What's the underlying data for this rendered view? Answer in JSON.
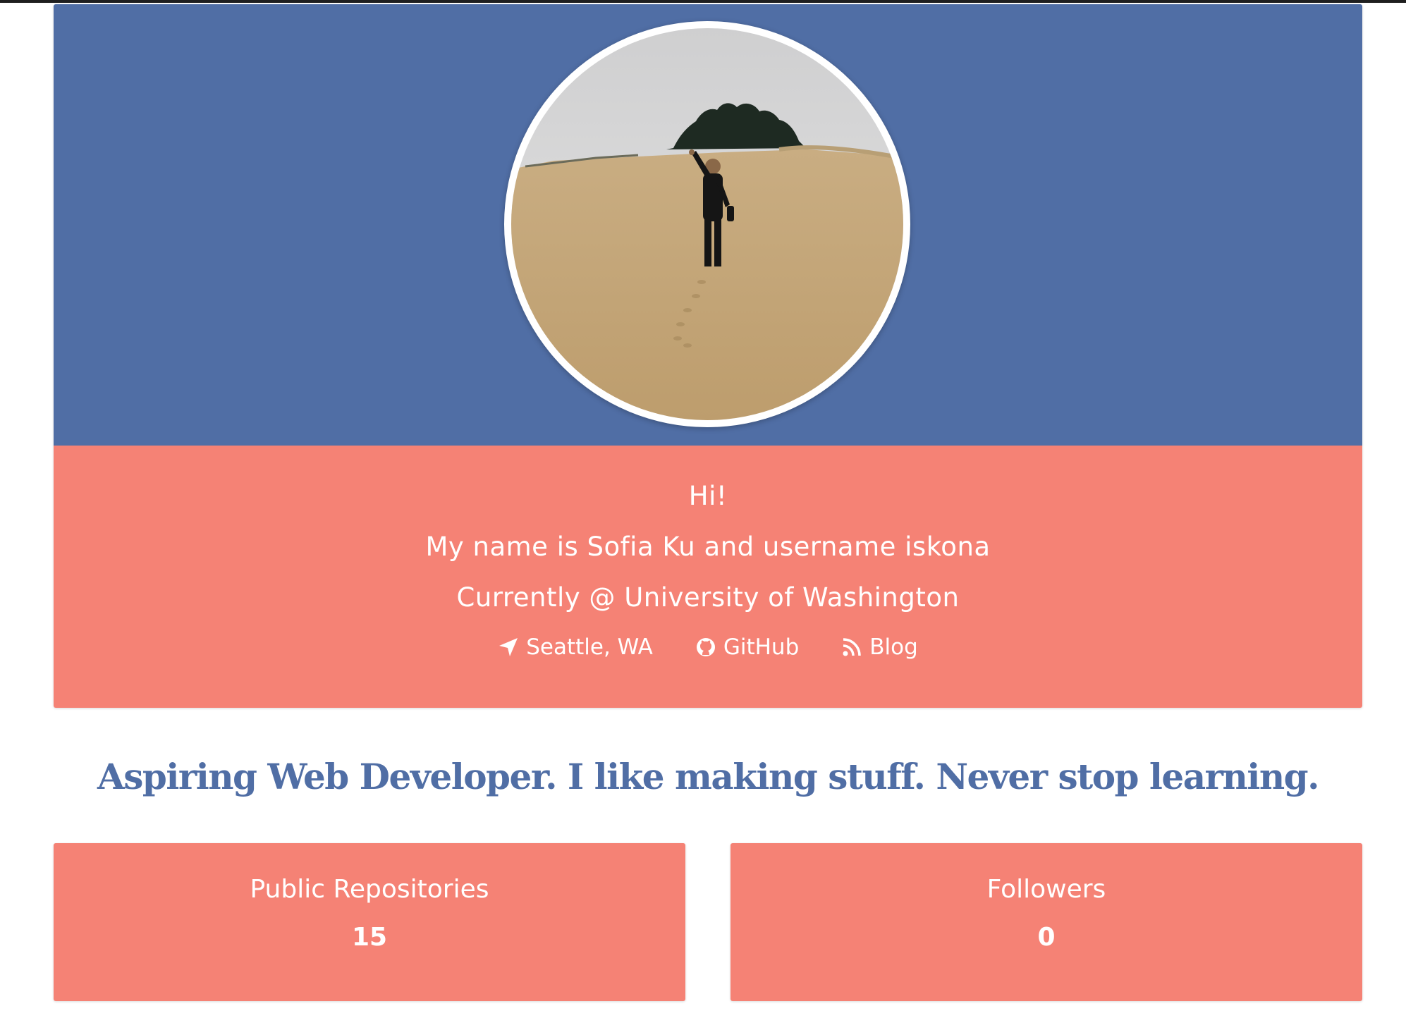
{
  "colors": {
    "primary_blue": "#506ea5",
    "salmon": "#f58275",
    "text_white": "#ffffff"
  },
  "profile": {
    "avatar_alt": "Profile photo"
  },
  "intro": {
    "greeting": "Hi!",
    "name_line": "My name is Sofia Ku and username iskona",
    "work_line": "Currently @ University of Washington"
  },
  "links": [
    {
      "icon": "location-arrow-icon",
      "label": "Seattle, WA"
    },
    {
      "icon": "github-icon",
      "label": "GitHub"
    },
    {
      "icon": "rss-icon",
      "label": "Blog"
    }
  ],
  "tagline": "Aspiring Web Developer. I like making stuff. Never stop learning.",
  "stats": [
    {
      "label": "Public Repositories",
      "value": "15"
    },
    {
      "label": "Followers",
      "value": "0"
    }
  ]
}
